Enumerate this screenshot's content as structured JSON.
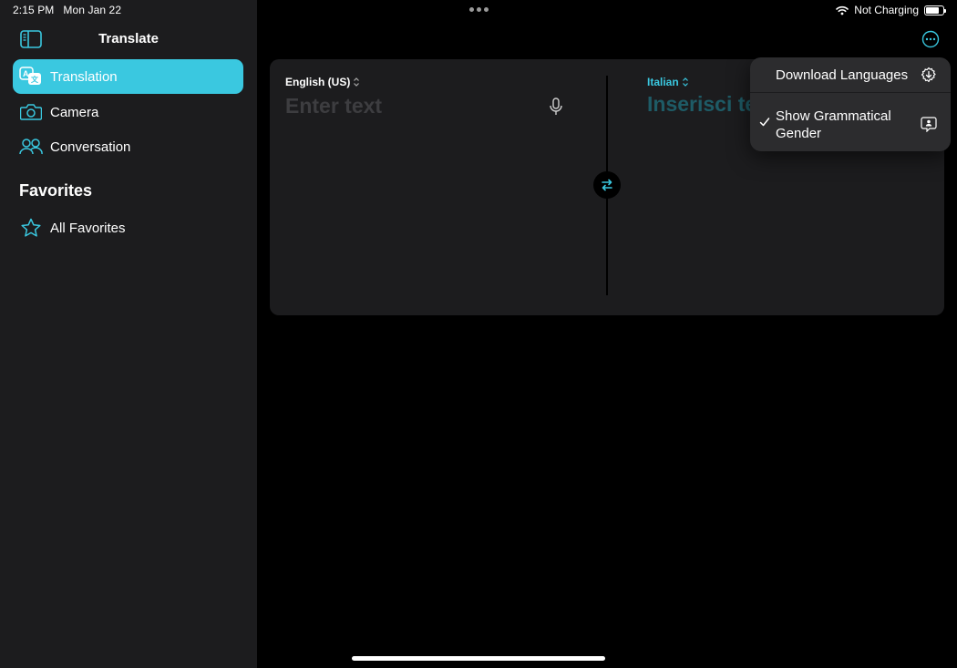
{
  "status_bar": {
    "time": "2:15 PM",
    "date": "Mon Jan 22",
    "charging": "Not Charging",
    "battery_level": 0.8
  },
  "sidebar": {
    "title": "Translate",
    "items": [
      {
        "label": "Translation",
        "icon": "translation-icon",
        "active": true
      },
      {
        "label": "Camera",
        "icon": "camera-icon",
        "active": false
      },
      {
        "label": "Conversation",
        "icon": "conversation-icon",
        "active": false
      }
    ],
    "favorites_header": "Favorites",
    "favorites_items": [
      {
        "label": "All Favorites",
        "icon": "star-icon"
      }
    ]
  },
  "translator": {
    "source_language": "English (US)",
    "target_language": "Italian",
    "input_placeholder": "Enter text",
    "input_value": "",
    "target_placeholder": "Inserisci testo"
  },
  "menu": {
    "items": [
      {
        "label": "Download Languages",
        "icon": "download-gear-icon",
        "checked": false
      },
      {
        "label": "Show Grammatical Gender",
        "icon": "person-bubble-icon",
        "checked": true
      }
    ]
  },
  "colors": {
    "accent": "#3ac8e0",
    "sidebar_bg": "#1c1c1e",
    "menu_bg": "#2c2c2e"
  }
}
